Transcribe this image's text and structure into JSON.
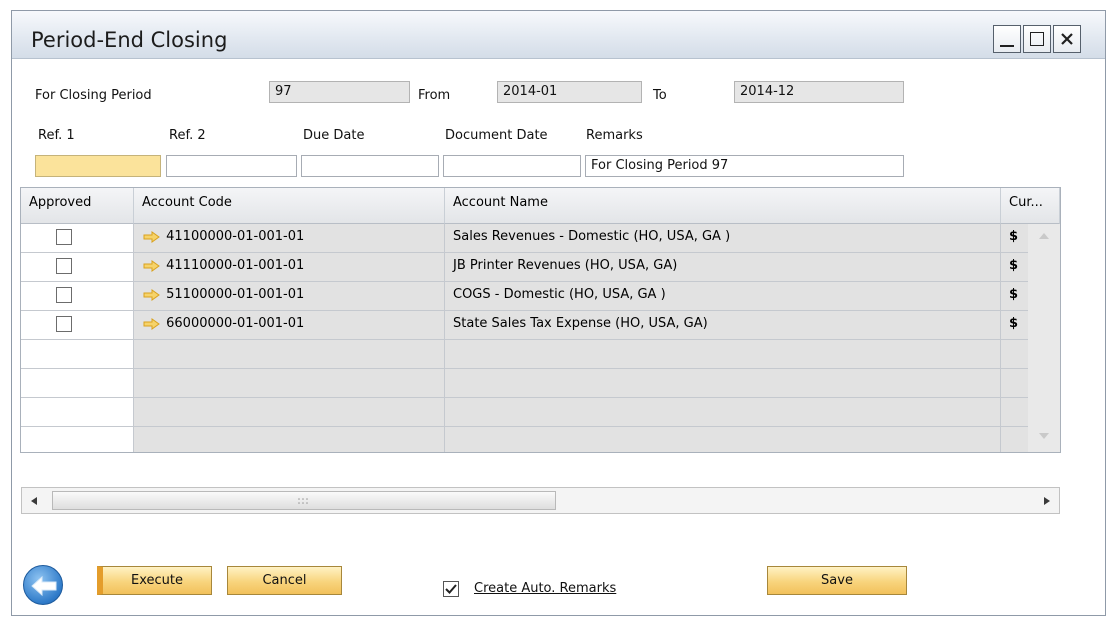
{
  "window": {
    "title": "Period-End Closing"
  },
  "header": {
    "for_closing_period_label": "For Closing Period",
    "for_closing_period_value": "97",
    "from_label": "From",
    "from_value": "2014-01",
    "to_label": "To",
    "to_value": "2014-12"
  },
  "refs": {
    "ref1_label": "Ref. 1",
    "ref2_label": "Ref. 2",
    "due_date_label": "Due Date",
    "document_date_label": "Document Date",
    "remarks_label": "Remarks",
    "ref1_value": "",
    "ref2_value": "",
    "due_date_value": "",
    "document_date_value": "",
    "remarks_value": "For Closing Period 97"
  },
  "grid": {
    "columns": [
      "Approved",
      "Account Code",
      "Account Name",
      "Cur..."
    ],
    "rows": [
      {
        "approved": false,
        "account_code": "41100000-01-001-01",
        "account_name": "Sales Revenues - Domestic (HO, USA, GA )",
        "currency": "$"
      },
      {
        "approved": false,
        "account_code": "41110000-01-001-01",
        "account_name": "JB Printer Revenues (HO, USA, GA)",
        "currency": "$"
      },
      {
        "approved": false,
        "account_code": "51100000-01-001-01",
        "account_name": "COGS - Domestic (HO, USA, GA )",
        "currency": "$"
      },
      {
        "approved": false,
        "account_code": "66000000-01-001-01",
        "account_name": "State Sales Tax Expense (HO, USA, GA)",
        "currency": "$"
      }
    ]
  },
  "footer": {
    "execute_label": "Execute",
    "cancel_label": "Cancel",
    "create_auto_remarks_label": "Create Auto. Remarks",
    "create_auto_remarks_checked": true,
    "save_label": "Save"
  },
  "icons": [
    "back-arrow-icon",
    "link-arrow-icon",
    "minimize-icon",
    "maximize-icon",
    "close-icon",
    "checkbox-icon"
  ],
  "colors": {
    "button_gold": "#f8d47d",
    "active_field": "#fbe39b",
    "link_arrow": "#f2c33c"
  }
}
